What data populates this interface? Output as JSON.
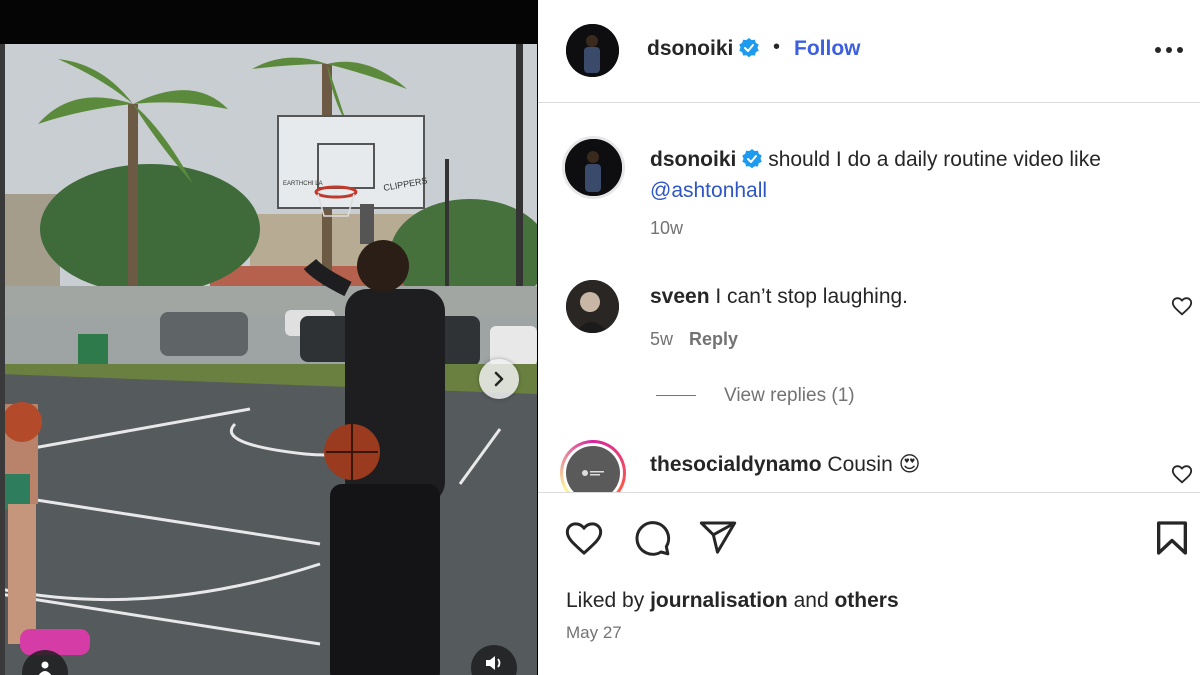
{
  "post": {
    "author": "dsonoiki",
    "follow_label": "Follow",
    "separator": "•",
    "caption": {
      "username": "dsonoiki",
      "text": "should I do a daily routine video like",
      "mention": "@ashtonhall",
      "age": "10w"
    },
    "comments": [
      {
        "username": "sveen",
        "text": "I can’t stop laughing.",
        "age": "5w",
        "reply_label": "Reply",
        "view_replies": "View replies (1)"
      },
      {
        "username": "thesocialdynamo",
        "text": "Cousin",
        "emoji": "😍"
      }
    ],
    "likes": {
      "prefix": "Liked by",
      "user": "journalisation",
      "middle": "and",
      "suffix": "others"
    },
    "date": "May 27",
    "backboard_text": [
      "EARTHCHI LA",
      "CLIPPERS"
    ]
  },
  "colors": {
    "accent": "#3b5fe0",
    "verified": "#1d9bf0",
    "mention": "#2e56c4",
    "muted": "#737373"
  },
  "icons": [
    "verified-icon",
    "more-icon",
    "heart-icon",
    "comment-icon",
    "share-icon",
    "bookmark-icon",
    "chevron-right-icon",
    "speaker-icon",
    "user-tag-icon"
  ]
}
